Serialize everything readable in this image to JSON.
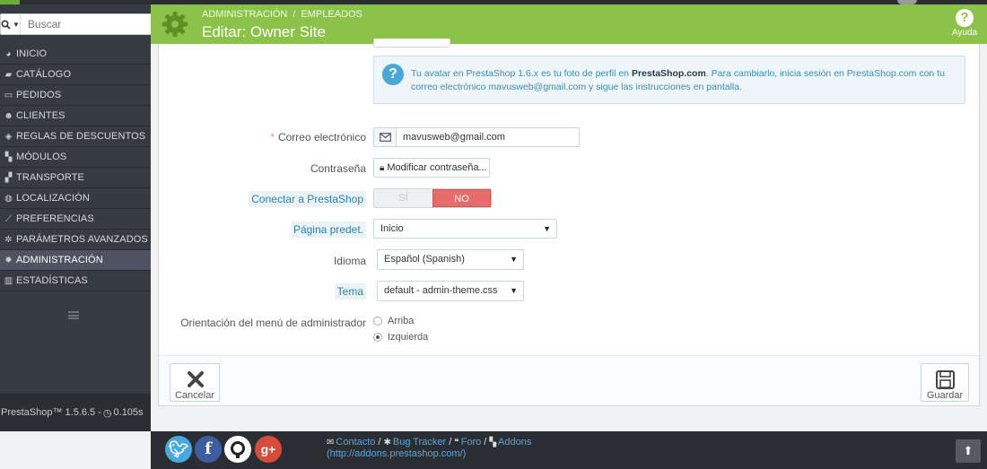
{
  "sidebar": {
    "search_placeholder": "Buscar",
    "items": [
      {
        "label": "INICIO",
        "icon": "dashboard-icon"
      },
      {
        "label": "CATÁLOGO",
        "icon": "book-icon"
      },
      {
        "label": "PEDIDOS",
        "icon": "credit-card-icon"
      },
      {
        "label": "CLIENTES",
        "icon": "users-icon"
      },
      {
        "label": "REGLAS DE DESCUENTOS",
        "icon": "tags-icon"
      },
      {
        "label": "MÓDULOS",
        "icon": "puzzle-icon"
      },
      {
        "label": "TRANSPORTE",
        "icon": "truck-icon"
      },
      {
        "label": "LOCALIZACIÓN",
        "icon": "globe-icon"
      },
      {
        "label": "PREFERENCIAS",
        "icon": "wrench-icon"
      },
      {
        "label": "PARÁMETROS AVANZADOS",
        "icon": "cogs-icon"
      },
      {
        "label": "ADMINISTRACIÓN",
        "icon": "gear-icon",
        "active": true
      },
      {
        "label": "ESTADÍSTICAS",
        "icon": "bar-chart-icon"
      }
    ],
    "footer_text": "PrestaShop™ 1.5.6.5 - ",
    "footer_time": "0.105s"
  },
  "header": {
    "breadcrumb": [
      "ADMINISTRACIÓN",
      "EMPLEADOS"
    ],
    "title": "Editar: Owner Site",
    "help_label": "Ayuda",
    "accent_color": "#8bc34a"
  },
  "form": {
    "avatar_note": {
      "pre": "Tu avatar en PrestaShop 1.6.x es tu foto de perfil en ",
      "bold": "PrestaShop.com",
      "post": ". Para cambiarlo, inicia sesión en PrestaShop.com con tu correo electrónico mavusweb@gmail.com y sigue las instrucciones en pantalla."
    },
    "email_label": "Correo electrónico",
    "email_value": "mavusweb@gmail.com",
    "password_label": "Contraseña",
    "password_button": "Modificar contraseña...",
    "connect_label": "Conectar a PrestaShop",
    "toggle_yes": "SÍ",
    "toggle_no": "NO",
    "default_page_label": "Página predet.",
    "default_page_value": "Inicio",
    "language_label": "Idioma",
    "language_value": "Español (Spanish)",
    "theme_label": "Tema",
    "theme_value": "default - admin-theme.css",
    "menu_orientation_label": "Orientación del menú de administrador",
    "orientation_options": [
      "Arriba",
      "Izquierda"
    ],
    "orientation_selected": "Izquierda",
    "cancel_label": "Cancelar",
    "save_label": "Guardar"
  },
  "footer": {
    "social": [
      "twitter",
      "facebook",
      "github",
      "google-plus"
    ],
    "links": [
      "Contacto",
      "Bug Tracker",
      "Foro",
      "Addons"
    ],
    "addons_url": "(http://addons.prestashop.com/)"
  }
}
